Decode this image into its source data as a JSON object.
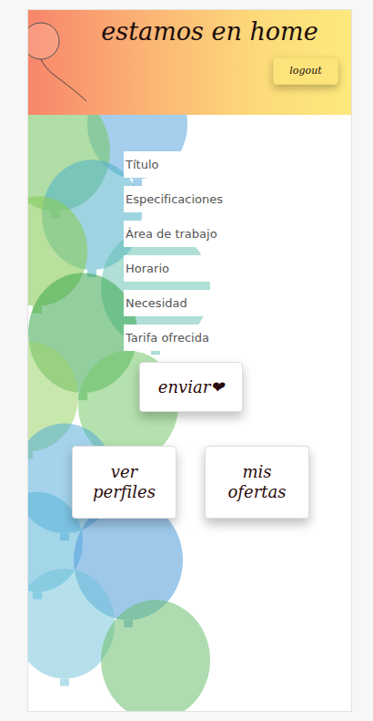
{
  "header": {
    "title": "estamos en home",
    "logout": "logout"
  },
  "form": {
    "fields": [
      {
        "placeholder": "Título"
      },
      {
        "placeholder": "Especificaciones"
      },
      {
        "placeholder": "Área de trabajo"
      },
      {
        "placeholder": "Horario"
      },
      {
        "placeholder": "Necesidad"
      },
      {
        "placeholder": "Tarifa ofrecida"
      }
    ],
    "submit": "enviar❤"
  },
  "nav_buttons": [
    "ver perfiles",
    "mis ofertas"
  ]
}
